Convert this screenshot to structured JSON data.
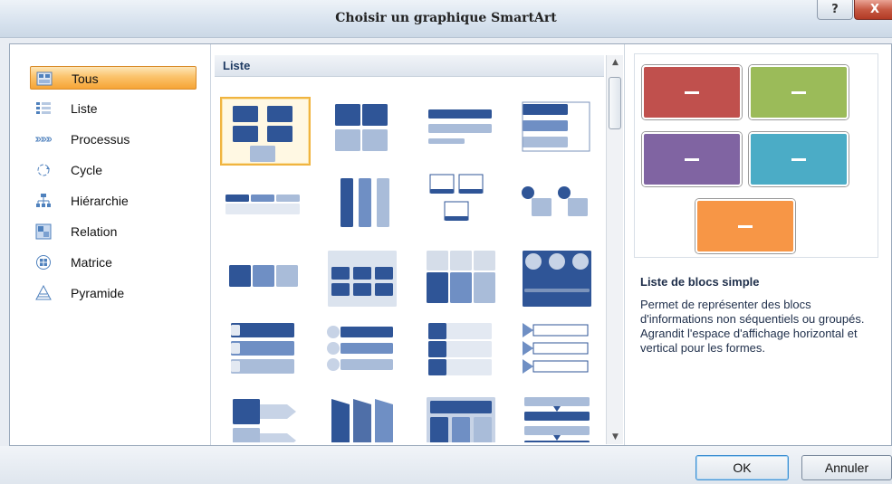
{
  "window": {
    "title": "Choisir un graphique SmartArt",
    "help_label": "?",
    "close_label": "X"
  },
  "categories": [
    {
      "label": "Tous",
      "icon": "all-icon",
      "selected": true
    },
    {
      "label": "Liste",
      "icon": "list-icon"
    },
    {
      "label": "Processus",
      "icon": "process-icon"
    },
    {
      "label": "Cycle",
      "icon": "cycle-icon"
    },
    {
      "label": "Hiérarchie",
      "icon": "hierarchy-icon"
    },
    {
      "label": "Relation",
      "icon": "relation-icon"
    },
    {
      "label": "Matrice",
      "icon": "matrix-icon"
    },
    {
      "label": "Pyramide",
      "icon": "pyramid-icon"
    }
  ],
  "gallery": {
    "header": "Liste",
    "selected_index": 0
  },
  "details": {
    "title": "Liste de blocs simple",
    "description": "Permet de représenter des blocs d'informations non séquentiels ou groupés. Agrandit l'espace d'affichage horizontal et vertical pour les formes.",
    "preview_colors": [
      "#c0504d",
      "#9bbb59",
      "#8064a2",
      "#4bacc6",
      "#f79646"
    ]
  },
  "buttons": {
    "ok": "OK",
    "cancel": "Annuler"
  },
  "colors": {
    "accent_blue": "#2f5597",
    "accent_light": "#a9bcd9",
    "selection_orange": "#f6a436"
  }
}
